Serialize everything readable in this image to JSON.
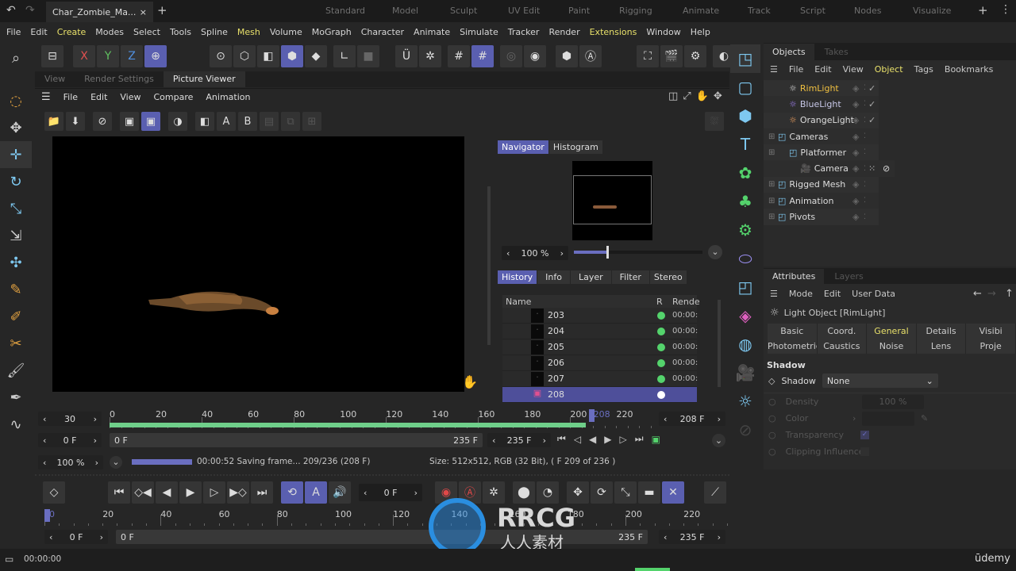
{
  "app": {
    "document_tab": "Char_Zombie_Ma...",
    "layouts": [
      "Standard",
      "Model",
      "Sculpt",
      "UV Edit",
      "Paint",
      "Rigging",
      "Animate",
      "Track",
      "Script",
      "Nodes",
      "Visualize"
    ]
  },
  "menu": [
    "File",
    "Edit",
    "Create",
    "Modes",
    "Select",
    "Tools",
    "Spline",
    "Mesh",
    "Volume",
    "MoGraph",
    "Character",
    "Animate",
    "Simulate",
    "Tracker",
    "Render",
    "Extensions",
    "Window",
    "Help"
  ],
  "axes": [
    "X",
    "Y",
    "Z"
  ],
  "viewer": {
    "tabs": [
      "View",
      "Render Settings",
      "Picture Viewer"
    ],
    "menu": [
      "File",
      "Edit",
      "View",
      "Compare",
      "Animation"
    ],
    "toolbar_letters": [
      "A",
      "B"
    ]
  },
  "navigator": {
    "tabs": [
      "Navigator",
      "Histogram"
    ],
    "zoom": "100 %",
    "zoom_slider": 0.25,
    "sub_tabs": [
      "History",
      "Info",
      "Layer",
      "Filter",
      "Stereo"
    ],
    "columns": [
      "Name",
      "R",
      "Rende"
    ],
    "rows": [
      {
        "name": "203",
        "time": "00:00:"
      },
      {
        "name": "204",
        "time": "00:00:"
      },
      {
        "name": "205",
        "time": "00:00:"
      },
      {
        "name": "206",
        "time": "00:00:"
      },
      {
        "name": "207",
        "time": "00:00:"
      },
      {
        "name": "208",
        "time": "",
        "selected": true
      }
    ]
  },
  "pv_timeline": {
    "fps": "30",
    "ticks": [
      "0",
      "20",
      "40",
      "60",
      "80",
      "100",
      "120",
      "140",
      "160",
      "180",
      "200",
      "208",
      "220"
    ],
    "current": "208 F",
    "start": "0 F",
    "range_start": "0 F",
    "range_end": "235 F",
    "end": "235 F",
    "progress": 0.88
  },
  "status": {
    "zoom": "100 %",
    "progress": 1.0,
    "message": "00:00:52 Saving frame... 209/236 (208 F)",
    "info": "Size: 512x512, RGB (32 Bit),  ( F 209 of 236 )"
  },
  "main_timeline": {
    "frame": "0 F",
    "ticks": [
      "0",
      "20",
      "40",
      "60",
      "80",
      "100",
      "120",
      "140",
      "160",
      "180",
      "200",
      "220"
    ],
    "start": "0 F",
    "range_start": "0 F",
    "range_end": "235 F",
    "end": "235 F"
  },
  "bottom": {
    "time": "00:00:00",
    "brand": "ūdemy"
  },
  "objects": {
    "tabs": [
      "Objects",
      "Takes"
    ],
    "menu": [
      "File",
      "Edit",
      "View",
      "Object",
      "Tags",
      "Bookmarks"
    ],
    "items": [
      {
        "name": "RimLight",
        "icon": "light-icon",
        "color": "#f0c040",
        "check": true,
        "indent": 1
      },
      {
        "name": "BlueLight",
        "icon": "light-icon",
        "color": "#c8c8e8",
        "check": true,
        "indent": 1
      },
      {
        "name": "OrangeLight",
        "icon": "light-icon",
        "color": "#dddddd",
        "check": true,
        "indent": 1
      },
      {
        "name": "Cameras",
        "icon": "null-icon",
        "color": "#dddddd",
        "indent": 0
      },
      {
        "name": "Platformer",
        "icon": "null-icon",
        "color": "#dddddd",
        "indent": 1
      },
      {
        "name": "Camera",
        "icon": "camera-icon",
        "color": "#dddddd",
        "indent": 2
      },
      {
        "name": "Rigged Mesh",
        "icon": "null-icon",
        "color": "#dddddd",
        "indent": 0
      },
      {
        "name": "Animation",
        "icon": "null-icon",
        "color": "#dddddd",
        "indent": 0
      },
      {
        "name": "Pivots",
        "icon": "null-icon",
        "color": "#dddddd",
        "indent": 0
      }
    ]
  },
  "attributes": {
    "tabs": [
      "Attributes",
      "Layers"
    ],
    "menu": [
      "Mode",
      "Edit",
      "User Data"
    ],
    "title": "Light Object [RimLight]",
    "tabs_row1": [
      "Basic",
      "Coord.",
      "General",
      "Details",
      "Visibi"
    ],
    "tabs_row2": [
      "Photometric",
      "Caustics",
      "Noise",
      "Lens",
      "Proje"
    ],
    "section": "Shadow",
    "shadow_label": "Shadow",
    "shadow_value": "None",
    "density_label": "Density",
    "density_value": "100 %",
    "color_label": "Color",
    "transparency_label": "Transparency",
    "clipping_label": "Clipping Influence"
  },
  "watermark": {
    "text": "RRCG",
    "sub": "人人素材"
  },
  "colors": {
    "accent": "#5a5fb0",
    "highlight": "#e8e06a",
    "green": "#54d36c"
  }
}
